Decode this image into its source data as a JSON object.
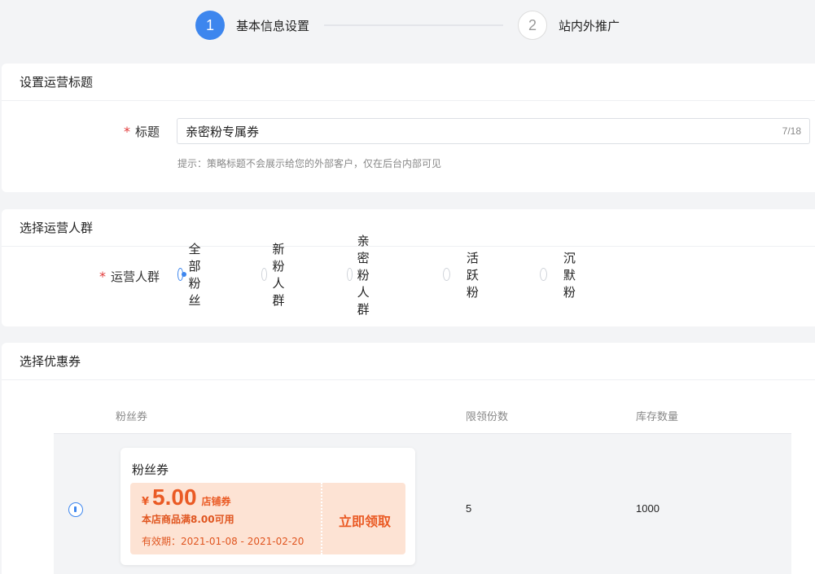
{
  "steps": [
    {
      "number": "1",
      "label": "基本信息设置"
    },
    {
      "number": "2",
      "label": "站内外推广"
    }
  ],
  "title_section": {
    "header": "设置运营标题",
    "required_mark": "*",
    "label": "标题",
    "input_value": "亲密粉专属券",
    "counter": "7/18",
    "hint": "提示：策略标题不会展示给您的外部客户，仅在后台内部可见"
  },
  "crowd_section": {
    "header": "选择运营人群",
    "required_mark": "*",
    "label": "运营人群",
    "options": [
      "全部粉丝",
      "新粉人群",
      "亲密粉人群",
      "活跃粉",
      "沉默粉"
    ],
    "selected": "全部粉丝"
  },
  "coupon_section": {
    "header": "选择优惠券",
    "columns": [
      "粉丝券",
      "限领份数",
      "库存数量"
    ],
    "rows": [
      {
        "coupon": {
          "name": "粉丝券",
          "currency": "¥",
          "amount": "5.00",
          "type": "店铺券",
          "condition": "本店商品满8.00可用",
          "validity": "有效期：2021-01-08 - 2021-02-20",
          "action": "立即领取"
        },
        "limit": "5",
        "stock": "1000"
      }
    ]
  },
  "colors": {
    "primary": "#3d86ee",
    "required": "#e23b3b",
    "coupon_bg": "#fde3d4",
    "coupon_text": "#ea5a24",
    "page_bg": "#f3f4f6"
  }
}
